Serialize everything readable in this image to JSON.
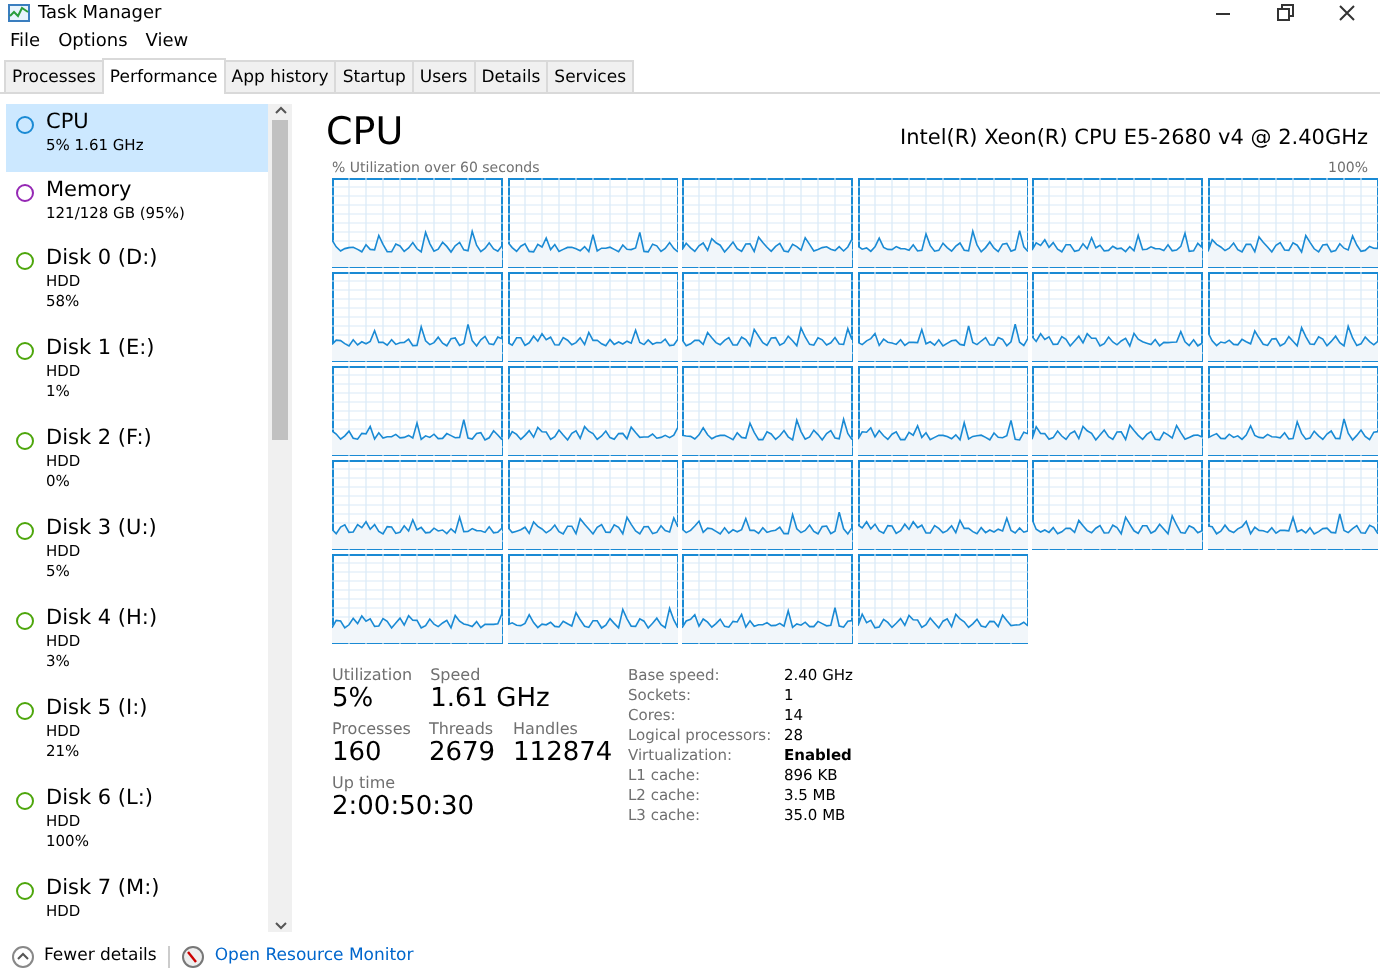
{
  "window": {
    "title": "Task Manager"
  },
  "menu": [
    "File",
    "Options",
    "View"
  ],
  "tabs": [
    {
      "label": "Processes",
      "selected": false
    },
    {
      "label": "Performance",
      "selected": true
    },
    {
      "label": "App history",
      "selected": false
    },
    {
      "label": "Startup",
      "selected": false
    },
    {
      "label": "Users",
      "selected": false
    },
    {
      "label": "Details",
      "selected": false
    },
    {
      "label": "Services",
      "selected": false
    }
  ],
  "sidebar": {
    "items": [
      {
        "name": "CPU",
        "lines": [
          "5% 1.61 GHz"
        ],
        "color": "#1a8ad4",
        "selected": true
      },
      {
        "name": "Memory",
        "lines": [
          "121/128 GB (95%)"
        ],
        "color": "#9528b4",
        "selected": false
      },
      {
        "name": "Disk 0 (D:)",
        "lines": [
          "HDD",
          "58%"
        ],
        "color": "#4da60c",
        "selected": false
      },
      {
        "name": "Disk 1 (E:)",
        "lines": [
          "HDD",
          "1%"
        ],
        "color": "#4da60c",
        "selected": false
      },
      {
        "name": "Disk 2 (F:)",
        "lines": [
          "HDD",
          "0%"
        ],
        "color": "#4da60c",
        "selected": false
      },
      {
        "name": "Disk 3 (U:)",
        "lines": [
          "HDD",
          "5%"
        ],
        "color": "#4da60c",
        "selected": false
      },
      {
        "name": "Disk 4 (H:)",
        "lines": [
          "HDD",
          "3%"
        ],
        "color": "#4da60c",
        "selected": false
      },
      {
        "name": "Disk 5 (I:)",
        "lines": [
          "HDD",
          "21%"
        ],
        "color": "#4da60c",
        "selected": false
      },
      {
        "name": "Disk 6 (L:)",
        "lines": [
          "HDD",
          "100%"
        ],
        "color": "#4da60c",
        "selected": false
      },
      {
        "name": "Disk 7 (M:)",
        "lines": [
          "HDD"
        ],
        "color": "#4da60c",
        "selected": false
      }
    ]
  },
  "detail": {
    "title": "CPU",
    "model": "Intel(R) Xeon(R) CPU E5-2680 v4 @ 2.40GHz",
    "graph_label": "% Utilization over 60 seconds",
    "graph_max": "100%",
    "stats": [
      [
        {
          "label": "Utilization",
          "value": "5%"
        },
        {
          "label": "Speed",
          "value": "1.61 GHz"
        }
      ],
      [
        {
          "label": "Processes",
          "value": "160"
        },
        {
          "label": "Threads",
          "value": "2679"
        },
        {
          "label": "Handles",
          "value": "112874"
        }
      ],
      [
        {
          "label": "Up time",
          "value": "2:00:50:30"
        }
      ]
    ],
    "specs": [
      {
        "label": "Base speed:",
        "value": "2.40 GHz"
      },
      {
        "label": "Sockets:",
        "value": "1"
      },
      {
        "label": "Cores:",
        "value": "14"
      },
      {
        "label": "Logical processors:",
        "value": "28"
      },
      {
        "label": "Virtualization:",
        "value": "Enabled"
      },
      {
        "label": "L1 cache:",
        "value": "896 KB"
      },
      {
        "label": "L2 cache:",
        "value": "3.5 MB"
      },
      {
        "label": "L3 cache:",
        "value": "35.0 MB"
      }
    ]
  },
  "footer": {
    "fewer": "Fewer details",
    "monitor": "Open Resource Monitor"
  }
}
